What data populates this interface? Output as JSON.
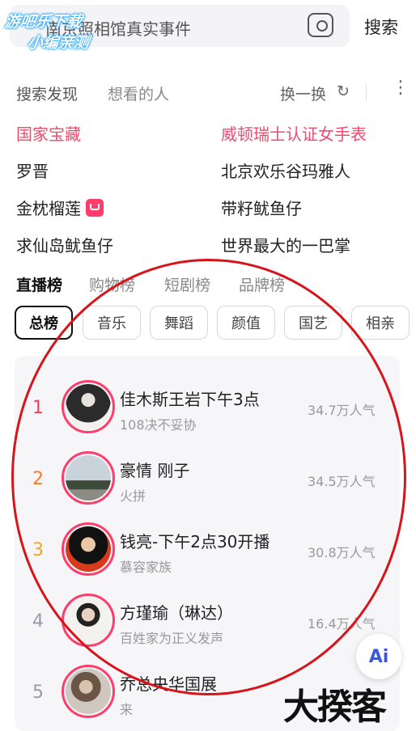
{
  "search": {
    "query": "南京照相馆真实事件",
    "button_label": "搜索",
    "camera_icon": "camera-icon"
  },
  "watermark": {
    "line1": "游吧乐下载",
    "line2": "小编亲测"
  },
  "discover": {
    "tab_discover": "搜索发现",
    "tab_want": "想看的人",
    "refresh_label": "换一换",
    "refresh_icon": "↻",
    "more_icon": "⋮",
    "suggestions": [
      {
        "text": "国家宝藏",
        "hot": true
      },
      {
        "text": "威顿瑞士认证女手表",
        "hot": true
      },
      {
        "text": "罗晋",
        "hot": false
      },
      {
        "text": "北京欢乐谷玛雅人",
        "hot": false
      },
      {
        "text": "金枕榴莲",
        "hot": false,
        "badge": "shop-bag-icon"
      },
      {
        "text": "带籽鱿鱼仔",
        "hot": false
      },
      {
        "text": "求仙岛鱿鱼仔",
        "hot": false
      },
      {
        "text": "世界最大的一巴掌",
        "hot": false
      }
    ]
  },
  "rank_tabs": [
    "直播榜",
    "购物榜",
    "短剧榜",
    "品牌榜"
  ],
  "chips": [
    "总榜",
    "音乐",
    "舞蹈",
    "颜值",
    "国艺",
    "相亲"
  ],
  "rank_list": [
    {
      "rank": "1",
      "rank_color": "#f03c5a",
      "name": "佳木斯王岩下午3点",
      "sub": "108决不妥协",
      "popularity": "34.7万人气"
    },
    {
      "rank": "2",
      "rank_color": "#ff7a28",
      "name": "豪情 刚子",
      "sub": "火拼",
      "popularity": "34.5万人气"
    },
    {
      "rank": "3",
      "rank_color": "#f5a623",
      "name": "钱亮-下午2点30开播",
      "sub": "慕容家族",
      "popularity": "30.8万人气"
    },
    {
      "rank": "4",
      "rank_color": "#9a9aa8",
      "name": "方瑾瑜（琳达）",
      "sub": "百姓家为正义发声",
      "popularity": "16.4万人气"
    },
    {
      "rank": "5",
      "rank_color": "#9a9aa8",
      "name": "乔总央华国展",
      "sub": "来",
      "popularity": ""
    }
  ],
  "ai_button": "Ai",
  "brand_watermark": "大揆客",
  "colors": {
    "accent": "#ff3c6a",
    "hot_text": "#f04a6e",
    "annotation": "#d8141b"
  }
}
